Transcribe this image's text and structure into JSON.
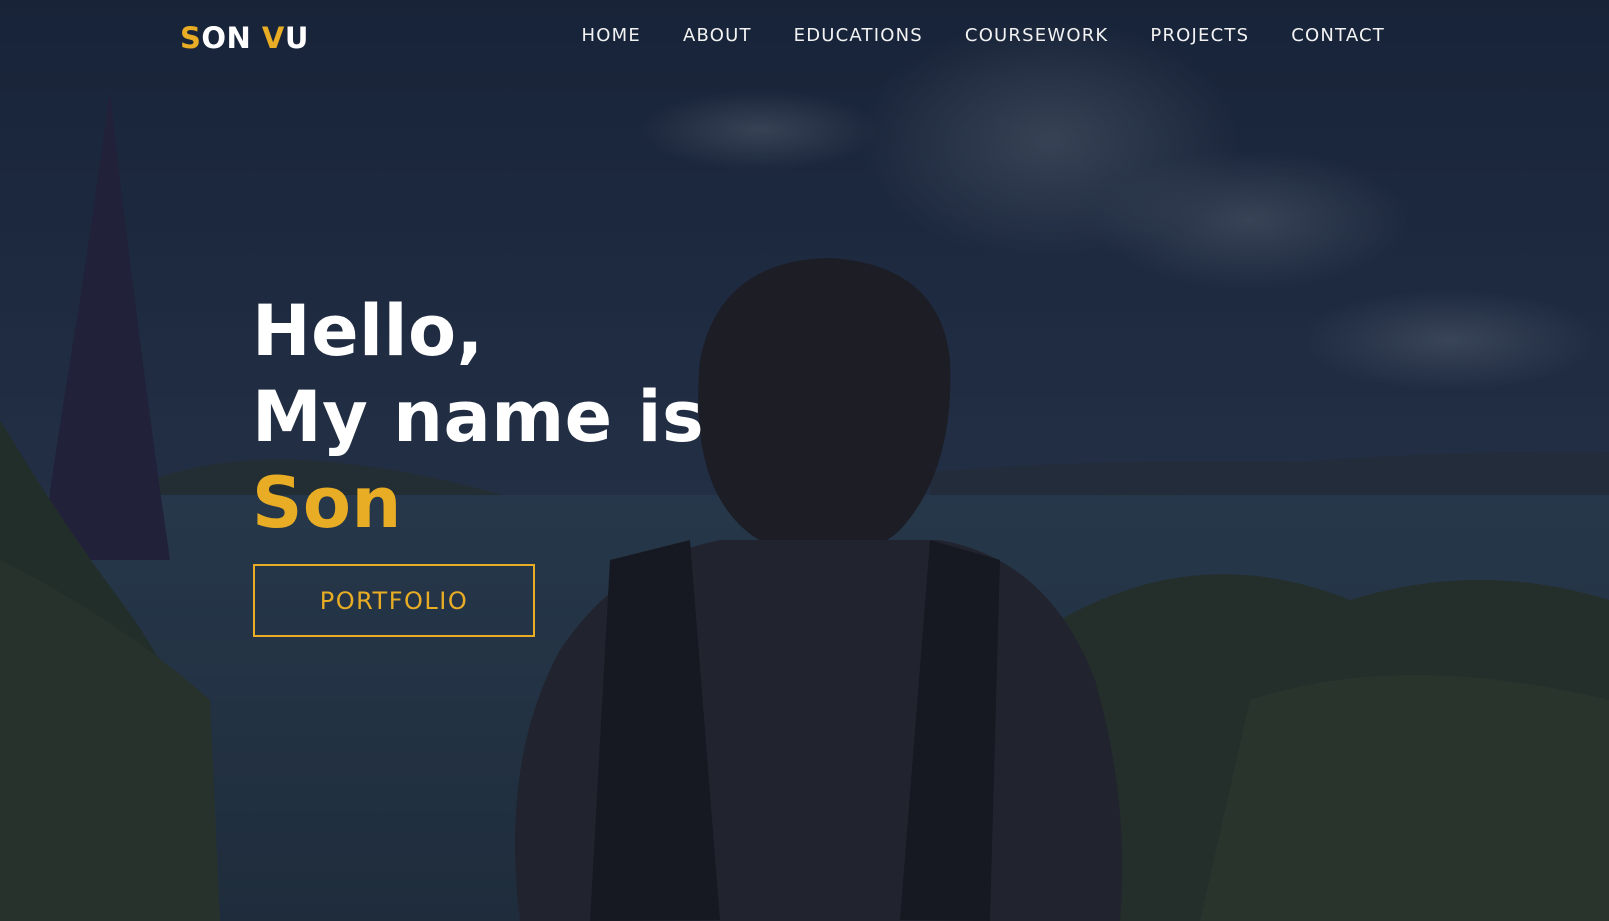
{
  "brand": {
    "part1_hl": "S",
    "part1_rest": "ON ",
    "part2_hl": "V",
    "part2_rest": "U"
  },
  "nav": {
    "items": [
      {
        "label": "HOME"
      },
      {
        "label": "ABOUT"
      },
      {
        "label": "EDUCATIONS"
      },
      {
        "label": "COURSEWORK"
      },
      {
        "label": "PROJECTS"
      },
      {
        "label": "CONTACT"
      }
    ]
  },
  "hero": {
    "greeting": "Hello,",
    "line2": "My name is",
    "name": "Son",
    "button_label": "PORTFOLIO"
  },
  "colors": {
    "accent": "#e8ad24",
    "overlay": "#1b2740"
  }
}
